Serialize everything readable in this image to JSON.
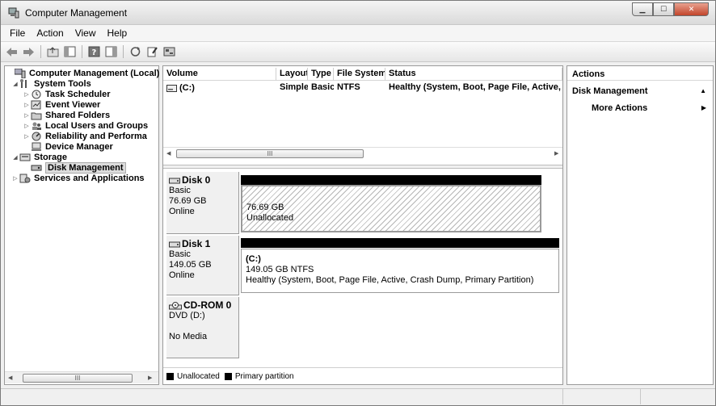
{
  "window": {
    "title": "Computer Management"
  },
  "menu": [
    "File",
    "Action",
    "View",
    "Help"
  ],
  "toolbar": {
    "icons": [
      "back-icon",
      "forward-icon",
      "up-folder-icon",
      "show-hide-tree-icon",
      "help-icon",
      "action-pane-icon",
      "refresh-icon",
      "properties-icon",
      "disk-settings-icon"
    ]
  },
  "tree": {
    "items": [
      {
        "label": "Computer Management (Local)"
      },
      {
        "label": "System Tools"
      },
      {
        "label": "Task Scheduler"
      },
      {
        "label": "Event Viewer"
      },
      {
        "label": "Shared Folders"
      },
      {
        "label": "Local Users and Groups"
      },
      {
        "label": "Reliability and Performa"
      },
      {
        "label": "Device Manager"
      },
      {
        "label": "Storage"
      },
      {
        "label": "Disk Management"
      },
      {
        "label": "Services and Applications"
      }
    ],
    "scroll_label": "III"
  },
  "volume_table": {
    "headers": [
      "Volume",
      "Layout",
      "Type",
      "File System",
      "Status"
    ],
    "rows": [
      {
        "volume": "(C:)",
        "layout": "Simple",
        "type": "Basic",
        "fs": "NTFS",
        "status": "Healthy (System, Boot, Page File, Active, C"
      }
    ],
    "scroll_label": "III"
  },
  "disks": [
    {
      "name": "Disk 0",
      "type": "Basic",
      "size": "76.69 GB",
      "status": "Online",
      "part_size": "76.69 GB",
      "part_label": "Unallocated"
    },
    {
      "name": "Disk 1",
      "type": "Basic",
      "size": "149.05 GB",
      "status": "Online",
      "vol_name": "(C:)",
      "part_size": "149.05 GB NTFS",
      "part_label": "Healthy (System, Boot, Page File, Active, Crash Dump, Primary Partition)"
    },
    {
      "name": "CD-ROM 0",
      "type": "DVD (D:)",
      "status": "No Media"
    }
  ],
  "legend": {
    "unallocated": "Unallocated",
    "primary": "Primary partition"
  },
  "actions": {
    "header": "Actions",
    "section": "Disk Management",
    "more": "More Actions"
  }
}
